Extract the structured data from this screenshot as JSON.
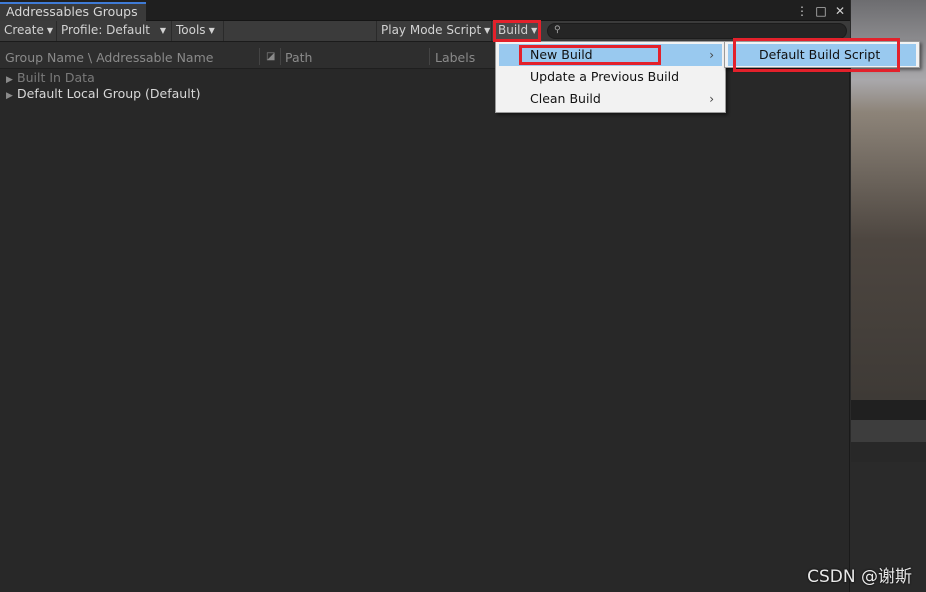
{
  "window": {
    "tab_title": "Addressables Groups"
  },
  "window_controls": {
    "more": "⋮",
    "maximize": "□",
    "close": "✕"
  },
  "toolbar": {
    "create": "Create",
    "profile": "Profile: Default",
    "tools": "Tools",
    "play_mode": "Play Mode Script",
    "build": "Build",
    "search_placeholder": ""
  },
  "columns": {
    "group_name": "Group Name \\ Addressable Name",
    "path": "Path",
    "labels": "Labels"
  },
  "tree": {
    "items": [
      {
        "label": "Built In Data",
        "disabled": true
      },
      {
        "label": "Default Local Group (Default)",
        "disabled": false
      }
    ]
  },
  "build_menu": {
    "items": [
      {
        "label": "New Build",
        "has_submenu": true,
        "highlighted": true
      },
      {
        "label": "Update a Previous Build",
        "has_submenu": false
      },
      {
        "label": "Clean Build",
        "has_submenu": true
      }
    ]
  },
  "new_build_submenu": {
    "items": [
      {
        "label": "Default Build Script",
        "highlighted": true
      }
    ]
  },
  "watermark": "CSDN @谢斯",
  "colors": {
    "highlight": "#99c9ef",
    "annotation_red": "#e3212b",
    "tab_accent": "#3f7bd6"
  }
}
